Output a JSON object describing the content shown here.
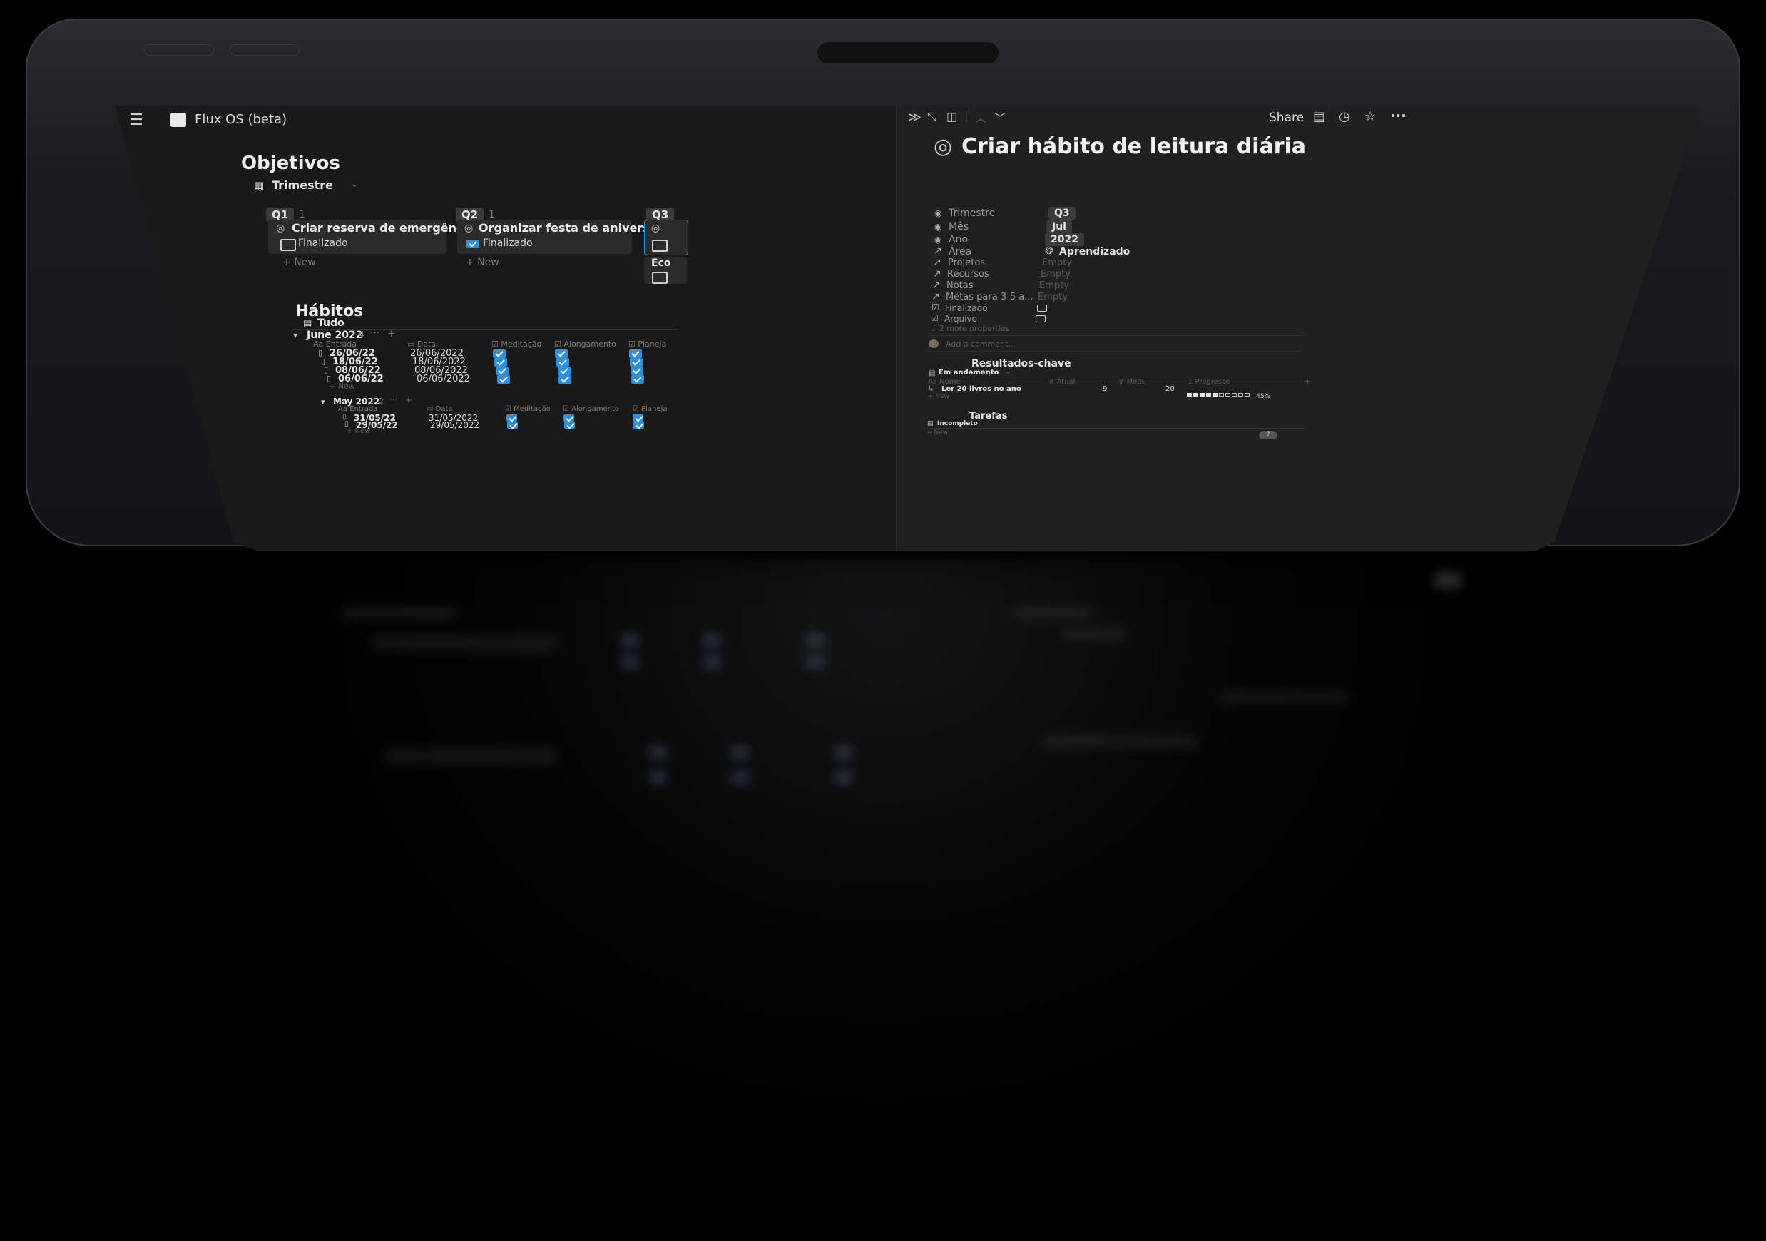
{
  "topbar": {
    "app_title": "Flux OS (beta)",
    "share_label": "Share"
  },
  "objetivos": {
    "title": "Objetivos",
    "view": "Trimestre",
    "groups": [
      {
        "tag": "Q1",
        "count": "1",
        "card_title": "Criar reserva de emergência",
        "status": "Finalizado",
        "done": false
      },
      {
        "tag": "Q2",
        "count": "1",
        "card_title": "Organizar festa de aniversário",
        "status": "Finalizado",
        "done": true
      },
      {
        "tag": "Q3",
        "count": "",
        "card_title": "Eco",
        "status": "",
        "done": false
      }
    ],
    "new_label": "New"
  },
  "habitos": {
    "title": "Hábitos",
    "view": "Tudo",
    "columns": [
      "Entrada",
      "Data",
      "Meditação",
      "Alongamento",
      "Planeja"
    ],
    "groups": [
      {
        "label": "June 2022",
        "count": "4",
        "rows": [
          {
            "entrada": "26/06/22",
            "data": "26/06/2022"
          },
          {
            "entrada": "18/06/22",
            "data": "18/06/2022"
          },
          {
            "entrada": "08/06/22",
            "data": "08/06/2022"
          },
          {
            "entrada": "06/06/22",
            "data": "06/06/2022"
          }
        ]
      },
      {
        "label": "May 2022",
        "count": "2",
        "rows": [
          {
            "entrada": "31/05/22",
            "data": "31/05/2022"
          },
          {
            "entrada": "29/05/22",
            "data": "29/05/2022"
          }
        ]
      }
    ],
    "new_label": "New"
  },
  "detail": {
    "title": "Criar hábito de leitura diária",
    "properties": [
      {
        "name": "Trimestre",
        "value": "Q3",
        "style": "tag"
      },
      {
        "name": "Mês",
        "value": "Jul",
        "style": "tag"
      },
      {
        "name": "Ano",
        "value": "2022",
        "style": "tag"
      },
      {
        "name": "Área",
        "value": "Aprendizado",
        "style": "relation"
      },
      {
        "name": "Projetos",
        "value": "Empty",
        "style": "empty"
      },
      {
        "name": "Recursos",
        "value": "Empty",
        "style": "empty"
      },
      {
        "name": "Notas",
        "value": "Empty",
        "style": "empty"
      },
      {
        "name": "Metas para 3-5 a...",
        "value": "Empty",
        "style": "empty"
      },
      {
        "name": "Finalizado",
        "value": "",
        "style": "checkbox"
      },
      {
        "name": "Arquivo",
        "value": "",
        "style": "checkbox"
      }
    ],
    "more_properties": "2 more properties",
    "comment_placeholder": "Add a comment...",
    "key_results": {
      "title": "Resultados-chave",
      "view": "Em andamento",
      "columns": [
        "Nome",
        "Atual",
        "Meta",
        "Progresso"
      ],
      "rows": [
        {
          "nome": "Ler 20 livros no ano",
          "atual": "9",
          "meta": "20",
          "progress_text": "45%",
          "progress": 0.45
        }
      ],
      "new_label": "New"
    },
    "tasks": {
      "title": "Tarefas",
      "view": "Incompleto",
      "new_label": "New"
    },
    "help": "?"
  }
}
